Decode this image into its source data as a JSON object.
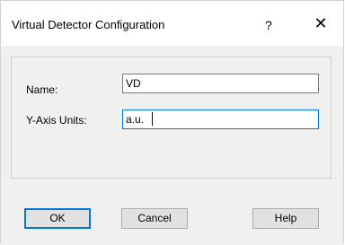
{
  "window": {
    "title": "Virtual Detector Configuration",
    "help_glyph": "?",
    "close_glyph": "✕"
  },
  "form": {
    "name_label": "Name:",
    "name_value": "VD",
    "units_label": "Y-Axis Units:",
    "units_value": "a.u."
  },
  "buttons": {
    "ok": "OK",
    "cancel": "Cancel",
    "help": "Help"
  },
  "colors": {
    "focus_accent": "#0078d7",
    "button_face": "#e1e1e1",
    "dialog_body": "#f0f0f0"
  }
}
